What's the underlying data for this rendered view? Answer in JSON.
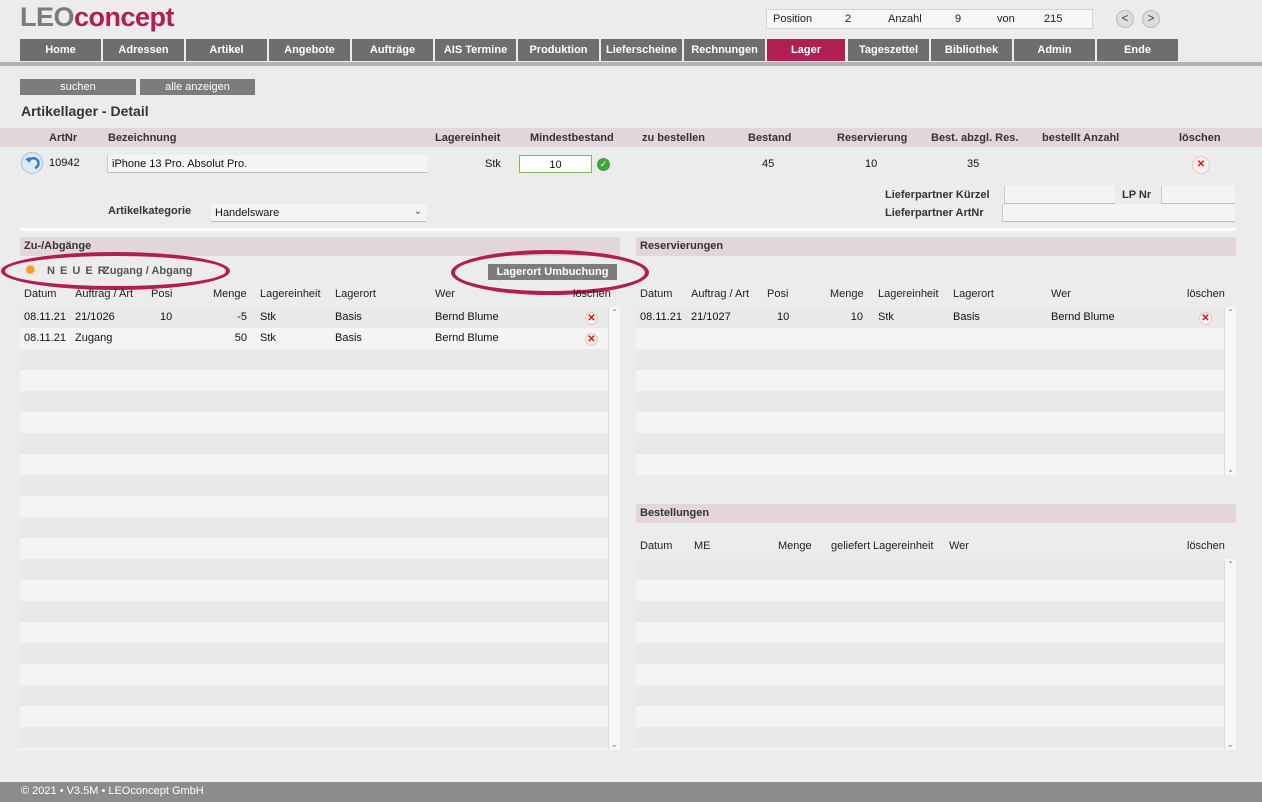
{
  "brand": {
    "part1": "LEO",
    "part2": "concept"
  },
  "pager": {
    "position_label": "Position",
    "position": "2",
    "count_label": "Anzahl",
    "count": "9",
    "of_label": "von",
    "total": "215",
    "prev": "<",
    "next": ">"
  },
  "nav": {
    "tabs": [
      "Home",
      "Adressen",
      "Artikel",
      "Angebote",
      "Aufträge",
      "AIS Termine",
      "Produktion",
      "Lieferscheine",
      "Rechnungen",
      "Lager",
      "Tageszettel",
      "Bibliothek",
      "Admin",
      "Ende"
    ],
    "active": "Lager"
  },
  "toolbar": {
    "search": "suchen",
    "show_all": "alle anzeigen"
  },
  "page_title": "Artikellager - Detail",
  "detail": {
    "headers": {
      "artnr": "ArtNr",
      "bezeichnung": "Bezeichnung",
      "lagereinheit": "Lagereinheit",
      "mindestbestand": "Mindestbestand",
      "zu_bestellen": "zu bestellen",
      "bestand": "Bestand",
      "reservierung": "Reservierung",
      "best_abzgl_res": "Best. abzgl. Res.",
      "bestellt_anzahl": "bestellt Anzahl",
      "loeschen": "löschen"
    },
    "artnr": "10942",
    "bezeichnung": "iPhone 13 Pro. Absolut Pro.",
    "lagereinheit": "Stk",
    "mindestbestand": "10",
    "zu_bestellen": "",
    "bestand": "45",
    "reservierung": "10",
    "best_abzgl_res": "35",
    "bestellt_anzahl": "",
    "kategorie_label": "Artikelkategorie",
    "kategorie": "Handelsware",
    "lp_kuerzel_label": "Lieferpartner Kürzel",
    "lp_kuerzel": "",
    "lp_nr_label": "LP Nr",
    "lp_nr": "",
    "lp_artnr_label": "Lieferpartner ArtNr",
    "lp_artnr": ""
  },
  "zugaenge": {
    "title": "Zu-/Abgänge",
    "new_prefix": "N E U E R",
    "new_label": "Zugang / Abgang",
    "umbuchung": "Lagerort Umbuchung",
    "columns": [
      "Datum",
      "Auftrag / Art",
      "Posi",
      "Menge",
      "Lagereinheit",
      "Lagerort",
      "Wer",
      "löschen"
    ],
    "rows": [
      {
        "datum": "08.11.21",
        "art": "21/1026",
        "posi": "10",
        "menge": "-5",
        "einheit": "Stk",
        "ort": "Basis",
        "wer": "Bernd Blume"
      },
      {
        "datum": "08.11.21",
        "art": "Zugang",
        "posi": "",
        "menge": "50",
        "einheit": "Stk",
        "ort": "Basis",
        "wer": "Bernd Blume"
      }
    ]
  },
  "reservierungen": {
    "title": "Reservierungen",
    "columns": [
      "Datum",
      "Auftrag / Art",
      "Posi",
      "Menge",
      "Lagereinheit",
      "Lagerort",
      "Wer",
      "löschen"
    ],
    "rows": [
      {
        "datum": "08.11.21",
        "art": "21/1027",
        "posi": "10",
        "menge": "10",
        "einheit": "Stk",
        "ort": "Basis",
        "wer": "Bernd Blume"
      }
    ]
  },
  "bestellungen": {
    "title": "Bestellungen",
    "columns": [
      "Datum",
      "ME",
      "Menge",
      "geliefert",
      "Lagereinheit",
      "Wer",
      "löschen"
    ]
  },
  "footer": "© 2021 • V3.5M • LEOconcept GmbH",
  "colors": {
    "accent": "#b01e52",
    "tab": "#6e6e6e",
    "section": "#e2d6db"
  }
}
